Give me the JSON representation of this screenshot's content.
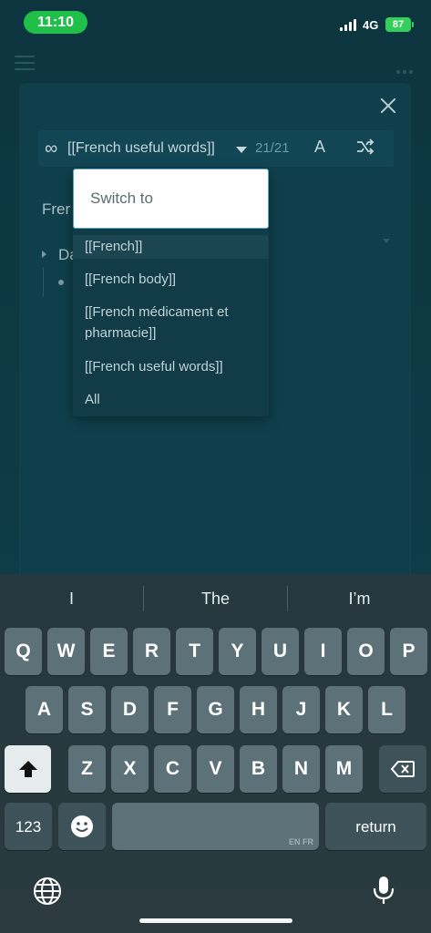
{
  "status_bar": {
    "time": "11:10",
    "network": "4G",
    "battery": "87"
  },
  "toolbar": {
    "deck_title": "[[French useful words]]",
    "counter": "21/21",
    "font_button": "A"
  },
  "page": {
    "line1": "Frer",
    "line2": "Da"
  },
  "dropdown": {
    "placeholder": "Switch to",
    "items": [
      {
        "label": "[[French]]"
      },
      {
        "label": "[[French body]]"
      },
      {
        "label": "[[French médicament et pharmacie]]"
      },
      {
        "label": "[[French useful words]]"
      },
      {
        "label": "All"
      }
    ]
  },
  "keyboard": {
    "suggestions": [
      "I",
      "The",
      "I’m"
    ],
    "row1": [
      "Q",
      "W",
      "E",
      "R",
      "T",
      "Y",
      "U",
      "I",
      "O",
      "P"
    ],
    "row2": [
      "A",
      "S",
      "D",
      "F",
      "G",
      "H",
      "J",
      "K",
      "L"
    ],
    "row3": [
      "Z",
      "X",
      "C",
      "V",
      "B",
      "N",
      "M"
    ],
    "numbers_key": "123",
    "space_lang": "EN FR",
    "return_key": "return"
  },
  "colors": {
    "accent_input_border": "#5aa7c9",
    "battery_green": "#32d05a",
    "time_pill": "#1fbf4a"
  }
}
